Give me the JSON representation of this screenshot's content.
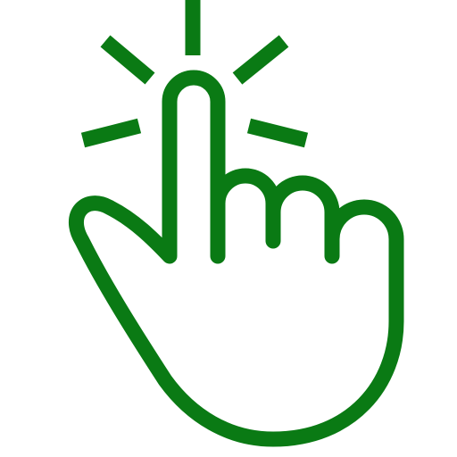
{
  "icon": {
    "name": "tap-gesture-icon",
    "stroke_color": "#0a7a14",
    "fill_color": "#ffffff",
    "background": "#ffffff"
  }
}
